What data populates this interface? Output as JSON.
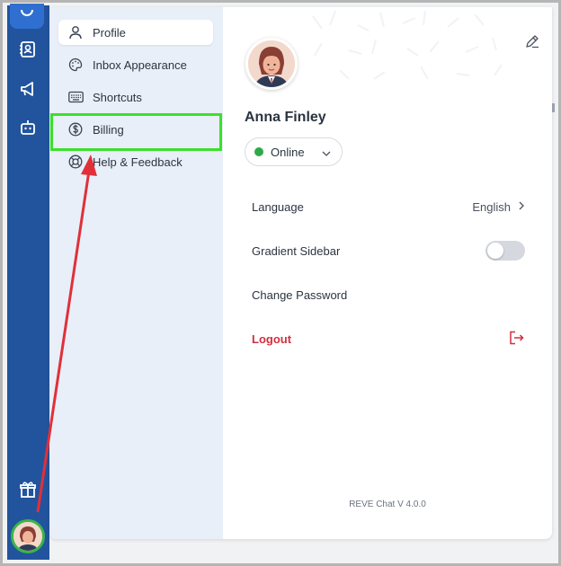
{
  "sidebar_rail": {
    "icons": [
      "gear-icon",
      "contacts-icon",
      "megaphone-icon",
      "bot-icon",
      "gift-icon"
    ]
  },
  "settings_menu": {
    "items": [
      {
        "label": "Profile",
        "icon": "user-icon",
        "active": true
      },
      {
        "label": "Inbox Appearance",
        "icon": "palette-icon",
        "active": false
      },
      {
        "label": "Shortcuts",
        "icon": "keyboard-icon",
        "active": false
      },
      {
        "label": "Billing",
        "icon": "dollar-icon",
        "active": false
      },
      {
        "label": "Help & Feedback",
        "icon": "lifebuoy-icon",
        "active": false
      }
    ]
  },
  "profile": {
    "name": "Anna Finley",
    "status": "Online",
    "status_color": "#2fa84a"
  },
  "settings": {
    "language_label": "Language",
    "language_value": "English",
    "gradient_sidebar_label": "Gradient Sidebar",
    "gradient_sidebar_enabled": false,
    "change_password_label": "Change Password",
    "logout_label": "Logout"
  },
  "version": "REVE Chat V 4.0.0",
  "colors": {
    "rail": "#22549e",
    "highlight": "#3be02a",
    "arrow": "#e0303a",
    "logout": "#d32f3f"
  }
}
